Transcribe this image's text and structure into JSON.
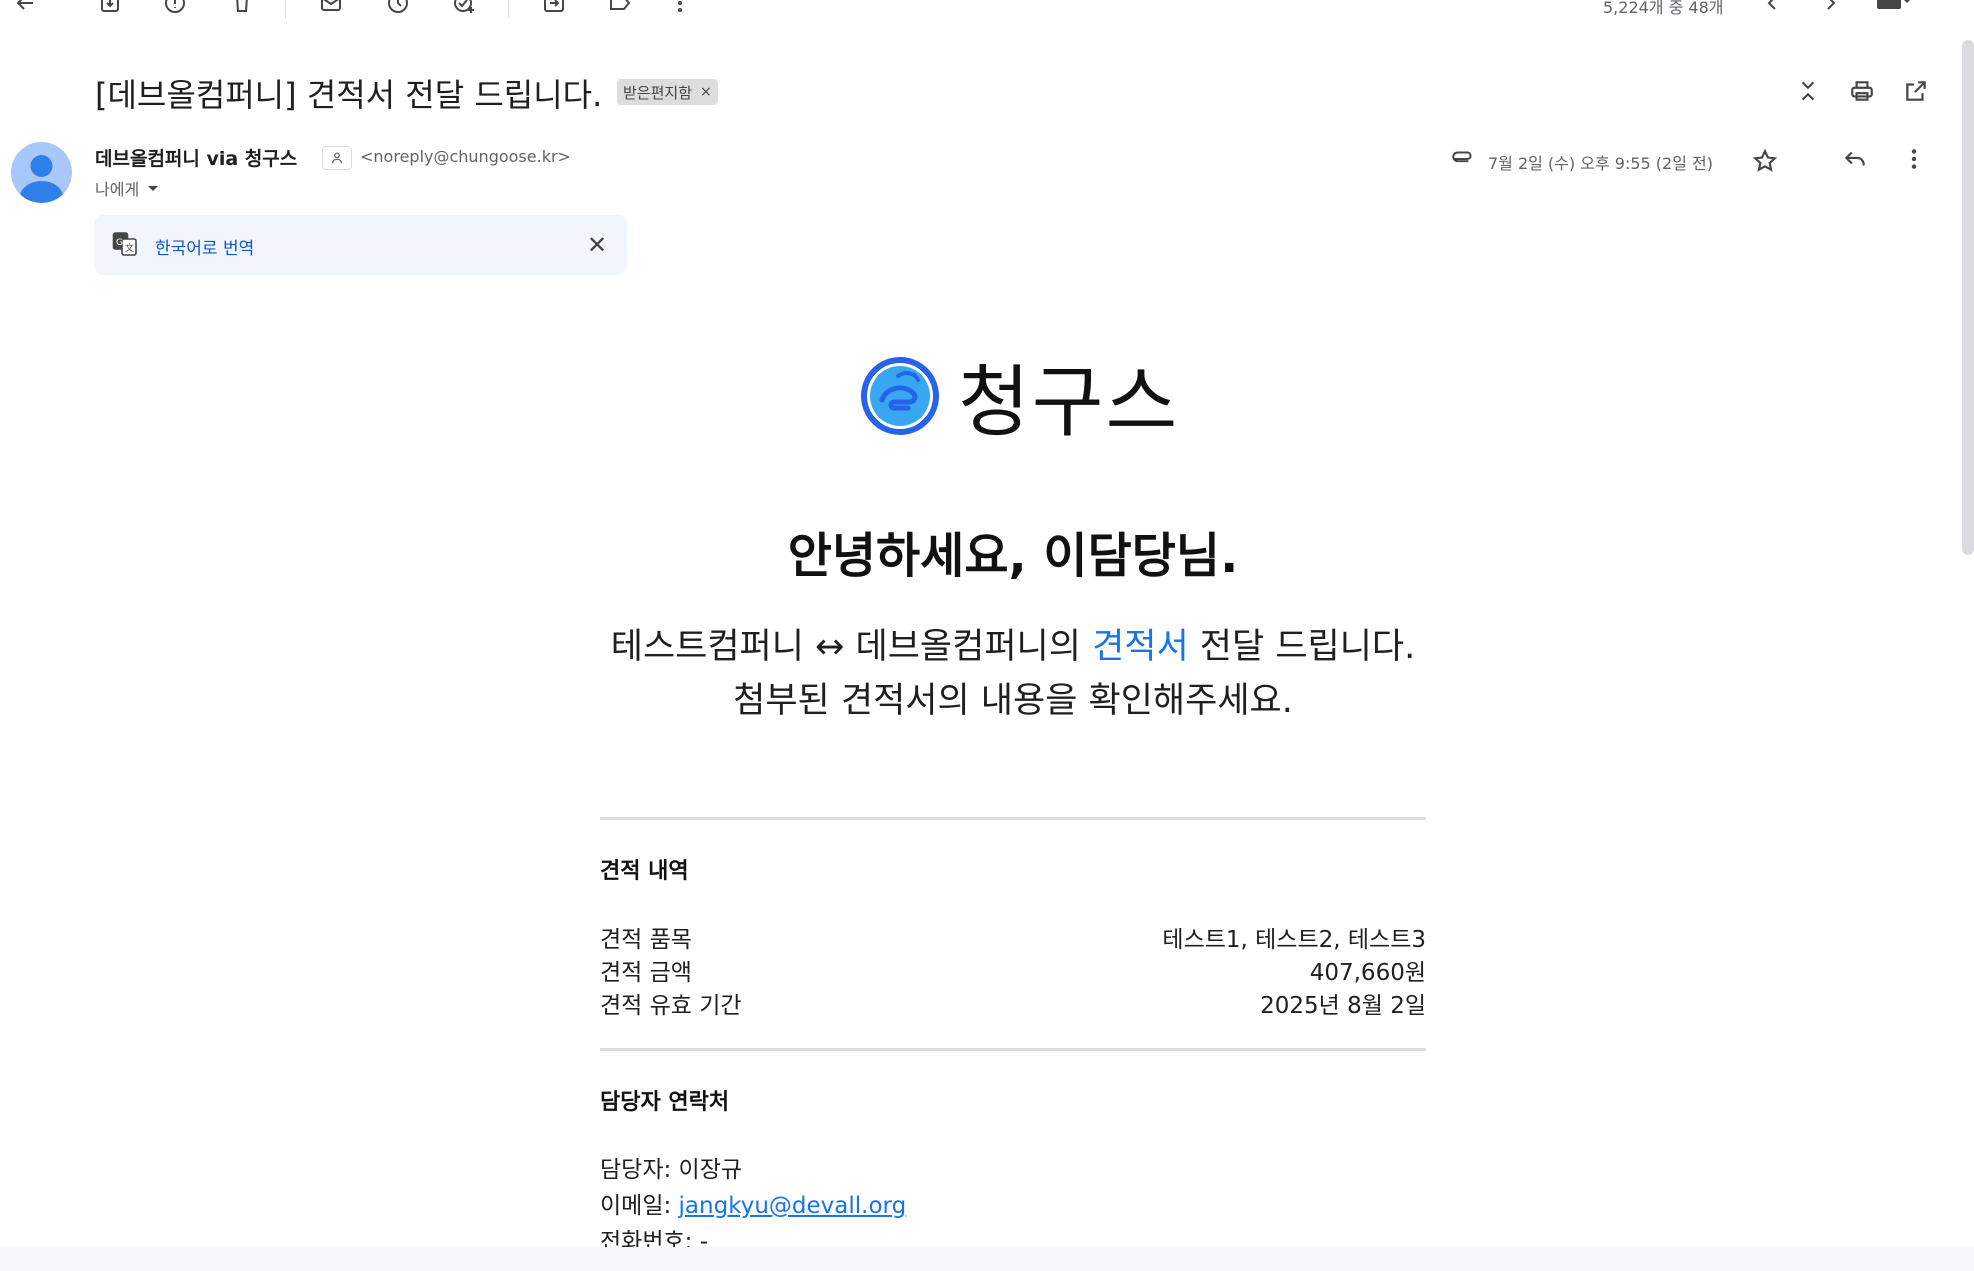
{
  "toolbar": {
    "counter": "5,224개 중 48개"
  },
  "email": {
    "subject": "[데브올컴퍼니] 견적서 전달 드립니다.",
    "label_chip": "받은편지함",
    "label_chip_close": "×",
    "sender_name": "데브올컴퍼니 via 청구스",
    "sender_email": "<noreply@chungoose.kr>",
    "to": "나에게",
    "date": "7월 2일 (수) 오후 9:55 (2일 전)"
  },
  "translate": {
    "label": "한국어로 번역",
    "close": "✕"
  },
  "body": {
    "logo_text": "청구스",
    "greeting": "안녕하세요, 이담당님.",
    "intro_part1": "테스트컴퍼니 ↔ 데브올컴퍼니의 ",
    "intro_link": "견적서",
    "intro_part2": " 전달 드립니다.",
    "intro_line2": "첨부된 견적서의 내용을 확인해주세요.",
    "quote_section": {
      "title": "견적 내역",
      "rows": [
        {
          "label": "견적 품목",
          "value": "테스트1, 테스트2, 테스트3"
        },
        {
          "label": "견적 금액",
          "value": "407,660원"
        },
        {
          "label": "견적 유효 기간",
          "value": "2025년 8월 2일"
        }
      ]
    },
    "contact_section": {
      "title": "담당자 연락처",
      "name_label": "담당자: ",
      "name": "이장규",
      "email_label": "이메일: ",
      "email": "jangkyu@devall.org",
      "phone_label": "전화번호: ",
      "phone": "-"
    }
  },
  "colors": {
    "accent": "#1a73e8",
    "logo_blue": "#2563eb",
    "translate_bg": "#f2f6fc"
  }
}
